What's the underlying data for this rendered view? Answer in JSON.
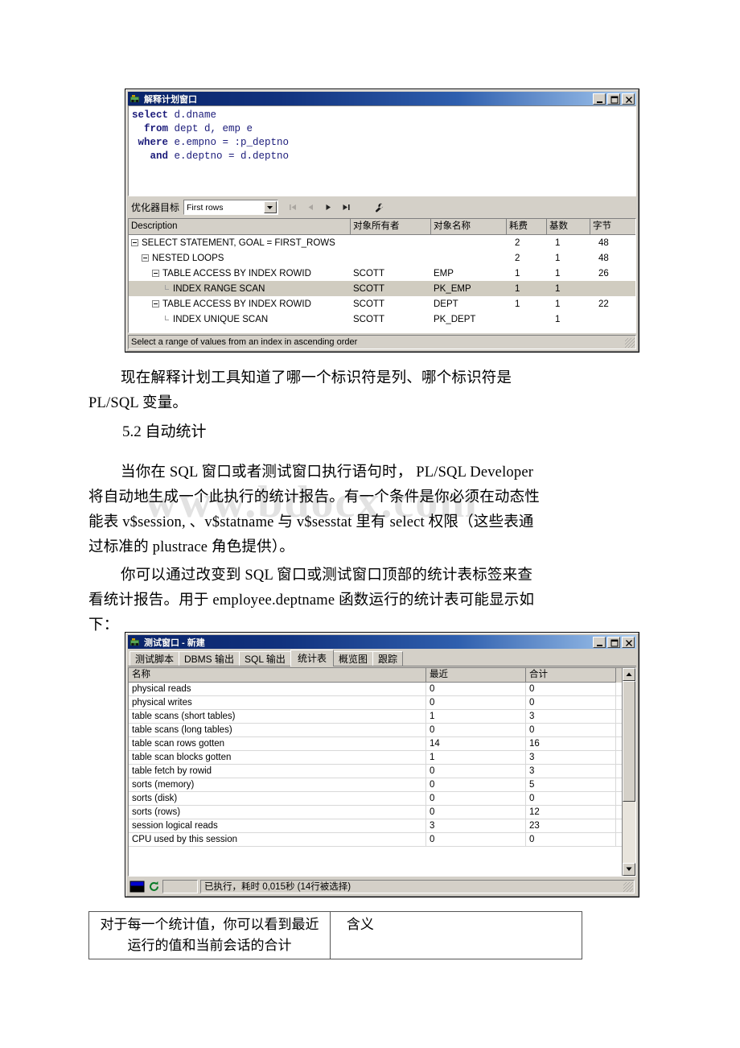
{
  "explain_window": {
    "title": "解释计划窗口",
    "app_icon": "plsql-app-icon",
    "buttons": {
      "minimize": "_",
      "maximize": "□",
      "close": "X"
    },
    "sql": {
      "line1_kw": "select",
      "line1_rest": " d.dname",
      "line2_kw": "from",
      "line2_rest": " dept d, emp e",
      "line3_kw": "where",
      "line3_rest": " e.empno = :p_deptno",
      "line4_kw": "and",
      "line4_rest": " e.deptno = d.deptno"
    },
    "toolbar": {
      "optimizer_label": "优化器目标",
      "optimizer_value": "First rows",
      "nav_first": "first-record",
      "nav_prev": "previous-record",
      "nav_next": "next-record",
      "nav_last": "last-record",
      "settings": "wrench-icon"
    },
    "grid": {
      "headers": [
        "Description",
        "对象所有者",
        "对象名称",
        "耗费",
        "基数",
        "字节"
      ],
      "rows": [
        {
          "indent": 0,
          "node": "expander",
          "desc": "SELECT STATEMENT, GOAL = FIRST_ROWS",
          "owner": "",
          "name": "",
          "cost": "2",
          "card": "1",
          "bytes": "48",
          "selected": false
        },
        {
          "indent": 1,
          "node": "expander",
          "desc": "NESTED LOOPS",
          "owner": "",
          "name": "",
          "cost": "2",
          "card": "1",
          "bytes": "48",
          "selected": false
        },
        {
          "indent": 2,
          "node": "expander",
          "desc": "TABLE ACCESS BY INDEX ROWID",
          "owner": "SCOTT",
          "name": "EMP",
          "cost": "1",
          "card": "1",
          "bytes": "26",
          "selected": false
        },
        {
          "indent": 3,
          "node": "leaf",
          "desc": "INDEX RANGE SCAN",
          "owner": "SCOTT",
          "name": "PK_EMP",
          "cost": "1",
          "card": "1",
          "bytes": "",
          "selected": true
        },
        {
          "indent": 2,
          "node": "expander",
          "desc": "TABLE ACCESS BY INDEX ROWID",
          "owner": "SCOTT",
          "name": "DEPT",
          "cost": "1",
          "card": "1",
          "bytes": "22",
          "selected": false
        },
        {
          "indent": 3,
          "node": "leaf",
          "desc": "INDEX UNIQUE SCAN",
          "owner": "SCOTT",
          "name": "PK_DEPT",
          "cost": "",
          "card": "1",
          "bytes": "",
          "selected": false
        }
      ]
    },
    "status": "Select a range of values from an index in ascending order"
  },
  "body": {
    "para1_line1": "现在解释计划工具知道了哪一个标识符是列、哪个标识符是",
    "para1_line2": "PL/SQL 变量。",
    "heading1": "5.2 自动统计",
    "para2_line1": "当你在 SQL 窗口或者测试窗口执行语句时， PL/SQL Developer",
    "para2_line2": "将自动地生成一个此执行的统计报告。有一个条件是你必须在动态性",
    "para2_line3": "能表 v$session, 、v$statname 与 v$sesstat 里有 select 权限（这些表通",
    "para2_line4": "过标准的 plustrace 角色提供）。",
    "para3_line1": "你可以通过改变到 SQL 窗口或测试窗口顶部的统计表标签来查",
    "para3_line2": "看统计报告。用于 employee.deptname 函数运行的统计表可能显示如",
    "para3_line3": "下：",
    "watermark": "www.bdocx.com"
  },
  "test_window": {
    "title": "测试窗口 - 新建",
    "app_icon": "plsql-app-icon",
    "buttons": {
      "minimize": "_",
      "maximize": "□",
      "close": "X"
    },
    "tabs": [
      {
        "label": "测试脚本",
        "active": false
      },
      {
        "label": "DBMS 输出",
        "active": false
      },
      {
        "label": "SQL 输出",
        "active": false
      },
      {
        "label": "统计表",
        "active": true
      },
      {
        "label": "概览图",
        "active": false
      },
      {
        "label": "跟踪",
        "active": false
      }
    ],
    "grid": {
      "headers": [
        "名称",
        "最近",
        "合计"
      ],
      "rows": [
        {
          "name": "physical reads",
          "recent": "0",
          "total": "0"
        },
        {
          "name": "physical writes",
          "recent": "0",
          "total": "0"
        },
        {
          "name": "table scans (short tables)",
          "recent": "1",
          "total": "3"
        },
        {
          "name": "table scans (long tables)",
          "recent": "0",
          "total": "0"
        },
        {
          "name": "table scan rows gotten",
          "recent": "14",
          "total": "16"
        },
        {
          "name": "table scan blocks gotten",
          "recent": "1",
          "total": "3"
        },
        {
          "name": "table fetch by rowid",
          "recent": "0",
          "total": "3"
        },
        {
          "name": "sorts (memory)",
          "recent": "0",
          "total": "5"
        },
        {
          "name": "sorts (disk)",
          "recent": "0",
          "total": "0"
        },
        {
          "name": "sorts (rows)",
          "recent": "0",
          "total": "12"
        },
        {
          "name": "session logical reads",
          "recent": "3",
          "total": "23"
        },
        {
          "name": "CPU used by this session",
          "recent": "0",
          "total": "0"
        }
      ]
    },
    "scrollbar": {
      "up": "scroll-up-arrow",
      "down": "scroll-down-arrow"
    },
    "status": {
      "session_icon": "session-indicator-icon",
      "refresh_icon": "refresh-icon",
      "message": "已执行，耗时 0,015秒 (14行被选择)"
    }
  },
  "bottom_table": {
    "cell_left": "对于每一个统计值，你可以看到最近运行的值和当前会话的合计",
    "cell_right": "含义"
  }
}
